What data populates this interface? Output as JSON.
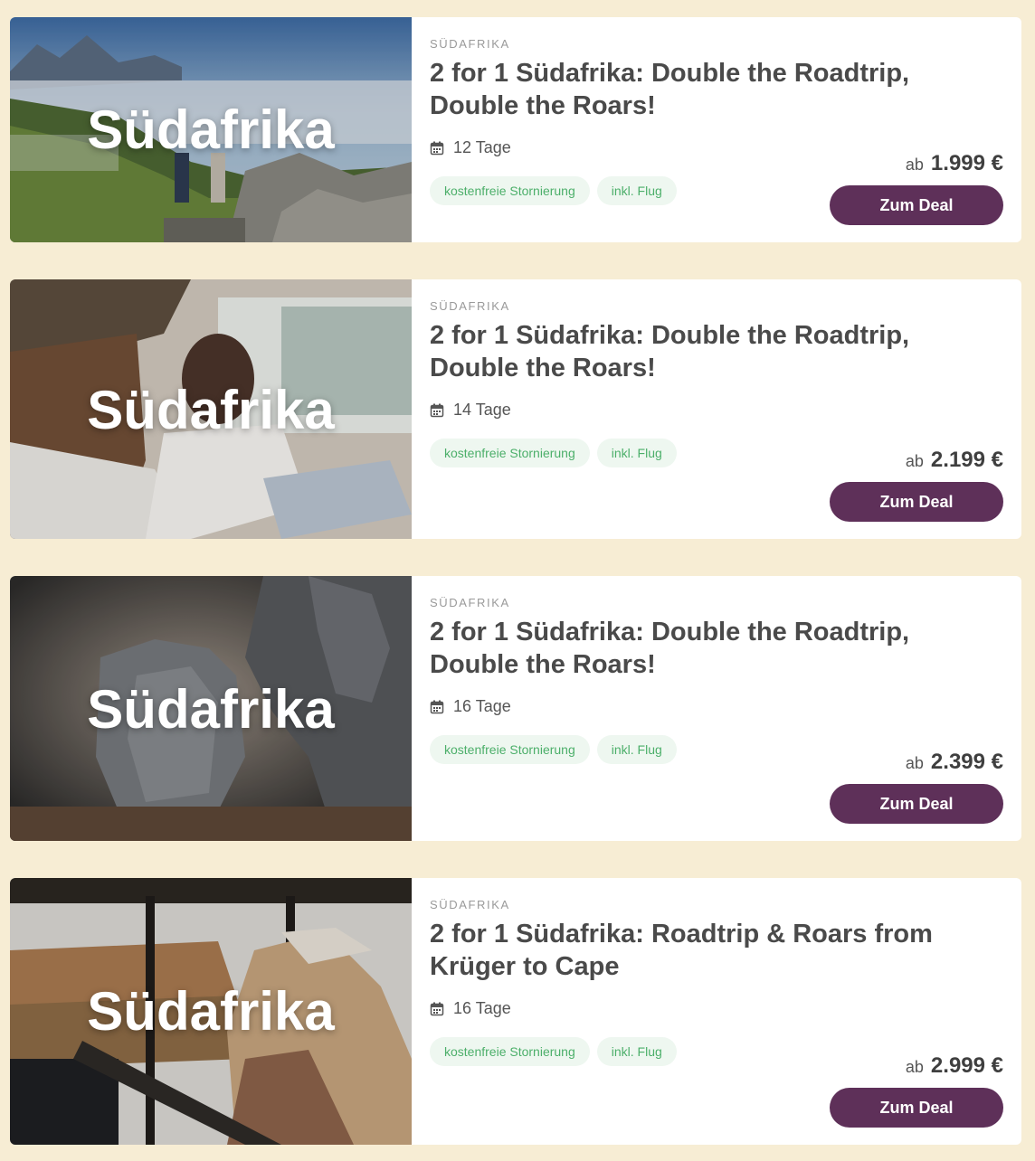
{
  "colors": {
    "page_background": "#f7edd4",
    "card_background": "#ffffff",
    "button": "#5e3059",
    "chip_background": "#eef7f0",
    "chip_text": "#4caf6a"
  },
  "icons": {
    "duration": "calendar-icon"
  },
  "deals": [
    {
      "image_title": "Südafrika",
      "kicker": "SÜDAFRIKA",
      "title": "2 for 1 Südafrika: Double the Roadtrip, Double the Roars!",
      "duration": "12 Tage",
      "chips": [
        "kostenfreie Stornierung",
        "inkl. Flug"
      ],
      "price_prefix": "ab",
      "price": "1.999 €",
      "button_label": "Zum Deal"
    },
    {
      "image_title": "Südafrika",
      "kicker": "SÜDAFRIKA",
      "title": "2 for 1 Südafrika: Double the Roadtrip, Double the Roars!",
      "duration": "14 Tage",
      "chips": [
        "kostenfreie Stornierung",
        "inkl. Flug"
      ],
      "price_prefix": "ab",
      "price": "2.199 €",
      "button_label": "Zum Deal"
    },
    {
      "image_title": "Südafrika",
      "kicker": "SÜDAFRIKA",
      "title": "2 for 1 Südafrika: Double the Roadtrip, Double the Roars!",
      "duration": "16 Tage",
      "chips": [
        "kostenfreie Stornierung",
        "inkl. Flug"
      ],
      "price_prefix": "ab",
      "price": "2.399 €",
      "button_label": "Zum Deal"
    },
    {
      "image_title": "Südafrika",
      "kicker": "SÜDAFRIKA",
      "title": "2 for 1 Südafrika: Roadtrip & Roars from Krüger to Cape",
      "duration": "16 Tage",
      "chips": [
        "kostenfreie Stornierung",
        "inkl. Flug"
      ],
      "price_prefix": "ab",
      "price": "2.999 €",
      "button_label": "Zum Deal"
    }
  ]
}
